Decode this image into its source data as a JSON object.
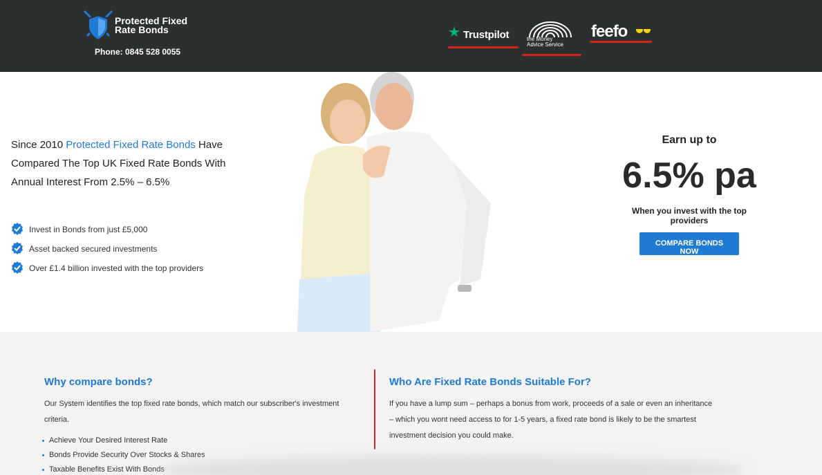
{
  "header": {
    "logo_text_line1": "Protected Fixed",
    "logo_text_line2": "Rate Bonds",
    "phone": "Phone: 0845 528 0055",
    "badges": {
      "trustpilot": "Trustpilot",
      "mas_line1": "the Money",
      "mas_line2": "Advice Service",
      "feefo": "feefo"
    }
  },
  "hero": {
    "intro_before": "Since 2010 ",
    "intro_highlight": "Protected Fixed Rate Bonds",
    "intro_after": " Have Compared The Top UK Fixed Rate Bonds With Annual Interest From 2.5% – 6.5%",
    "checks": [
      "Invest in Bonds from just £5,000",
      "Asset backed secured investments",
      "Over £1.4 billion invested with the top providers"
    ],
    "offer": {
      "earn": "Earn up to",
      "rate": "6.5% pa",
      "sub": "When you invest with the top providers",
      "cta": "COMPARE BONDS NOW"
    }
  },
  "lower": {
    "left": {
      "title": "Why compare bonds?",
      "body": "Our System identifies the top fixed rate bonds, which match our subscriber's investment criteria.",
      "bullets": [
        "Achieve Your Desired Interest Rate",
        "Bonds Provide Security Over Stocks & Shares",
        "Taxable Benefits Exist With Bonds"
      ]
    },
    "right": {
      "title": "Who Are Fixed Rate Bonds Suitable For?",
      "body": "If you have a lump sum – perhaps a bonus from work, proceeds of a sale or even an inheritance – which you wont need access to for 1-5 years, a fixed rate bond is likely to be the smartest investment decision you could make."
    }
  },
  "colors": {
    "header_bg": "#2b2f2e",
    "accent_blue": "#1f7ad6",
    "accent_red": "#d6241c",
    "trustpilot_green": "#00b67a",
    "section_bg": "#f3f3f3"
  },
  "icons": [
    "shield-swords-icon",
    "trustpilot-star-icon",
    "rainbow-arches-icon",
    "feefo-eyes-icon",
    "check-badge-icon"
  ]
}
